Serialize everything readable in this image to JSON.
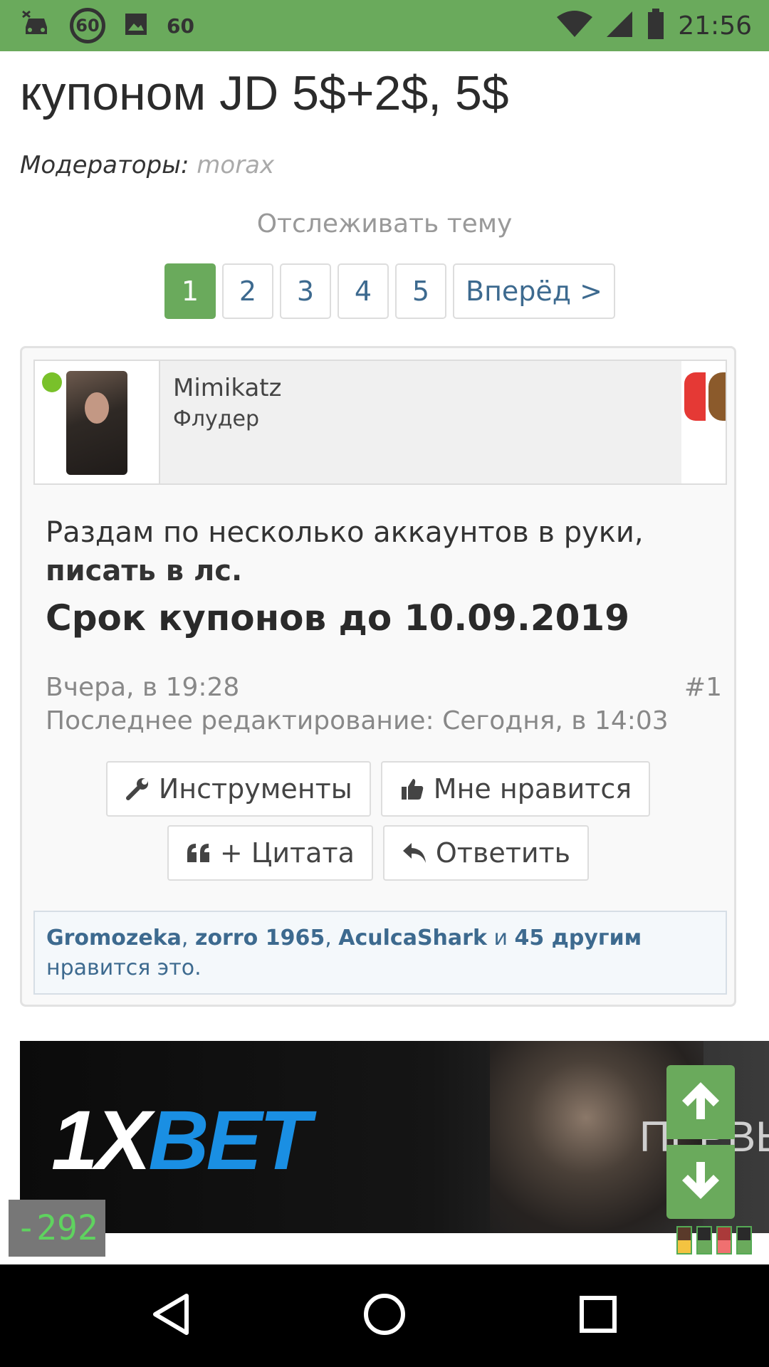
{
  "status_bar": {
    "badge_number": "60",
    "text": "60",
    "time": "21:56"
  },
  "thread": {
    "title": "купоном JD 5$+2$, 5$",
    "moderators_label": "Модераторы:",
    "moderator": "morax",
    "watch_label": "Отслеживать тему"
  },
  "pagination": {
    "pages": [
      "1",
      "2",
      "3",
      "4",
      "5"
    ],
    "active": "1",
    "next_label": "Вперёд >"
  },
  "post": {
    "username": "Mimikatz",
    "user_title": "Флудер",
    "message_line1": "Раздам по несколько аккаунтов в руки,",
    "message_line2": "писать в лс.",
    "message_line3": "Срок купонов до 10.09.2019",
    "posted_at": "Вчера, в 19:28",
    "post_number": "#1",
    "edited": "Последнее редактирование: Сегодня, в 14:03",
    "actions": {
      "tools": "Инструменты",
      "like": "Мне нравится",
      "quote": "+ Цитата",
      "reply": "Ответить"
    },
    "likes": {
      "user1": "Gromozeka",
      "sep1": ", ",
      "user2": "zorro 1965",
      "sep2": ", ",
      "user3": "AculcaShark",
      "and": " и ",
      "others": "45 другим",
      "suffix": "нравится это."
    }
  },
  "ad": {
    "logo_1x": "1X",
    "logo_bet": "BET",
    "side_text": "ПЕРВЫ"
  },
  "overlay": {
    "counter": "-292"
  },
  "colors": {
    "accent_green": "#6aaa5c",
    "link_blue": "#3d6a8f",
    "brand_blue": "#1a8fe3"
  },
  "icons": [
    "wrench-icon",
    "thumbs-up-icon",
    "quote-icon",
    "reply-icon",
    "arrow-up-icon",
    "arrow-down-icon",
    "back-icon",
    "home-icon",
    "recents-icon",
    "wifi-icon",
    "signal-icon",
    "battery-icon"
  ]
}
